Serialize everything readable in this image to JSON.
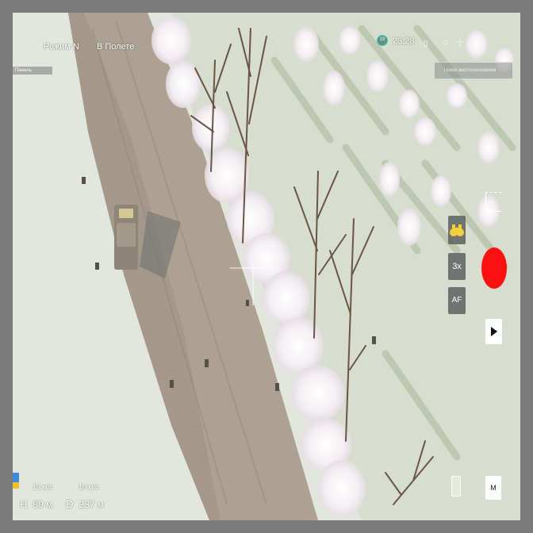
{
  "hud": {
    "mode_label": "Режим N",
    "flight_status": "В Полете",
    "panel_tab": "Панель",
    "satellites": "33",
    "clock": "23:28",
    "search_placeholder": "Поиск местоположения"
  },
  "controls": {
    "zoom_label": "3x",
    "af_label": "AF",
    "map_label": "M"
  },
  "telemetry": {
    "vertical_speed": "15 м/с",
    "horizontal_speed": "10 м/с",
    "height_label": "H",
    "height_value": "80 м",
    "distance_label": "D",
    "distance_value": "237 м"
  },
  "colors": {
    "record": "#ff1010",
    "satellite_ring": "#3fd0b0",
    "snow_ground": "#dfe3dc",
    "road": "#a89d8e"
  },
  "icons": {
    "binoculars": "binoculars-icon",
    "play": "play-icon",
    "battery": "battery-icon",
    "drone": "drone-icon"
  }
}
